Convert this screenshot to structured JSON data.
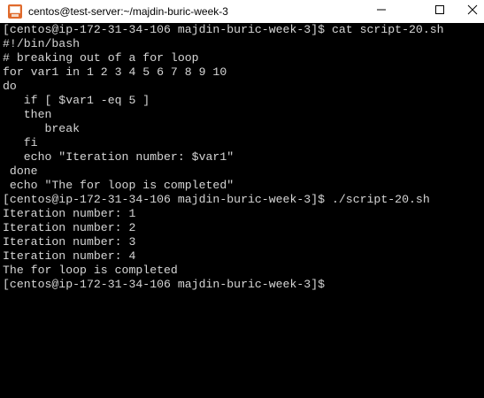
{
  "window": {
    "title": "centos@test-server:~/majdin-buric-week-3",
    "app_icon": "putty-terminal-icon",
    "controls": {
      "minimize_icon": "minimize-icon",
      "maximize_icon": "maximize-icon",
      "close_icon": "close-icon"
    }
  },
  "terminal": {
    "colors": {
      "background": "#000000",
      "foreground": "#d6d6d6"
    },
    "lines": [
      "[centos@ip-172-31-34-106 majdin-buric-week-3]$ cat script-20.sh",
      "#!/bin/bash",
      "# breaking out of a for loop",
      "for var1 in 1 2 3 4 5 6 7 8 9 10",
      "do",
      "   if [ $var1 -eq 5 ]",
      "   then",
      "      break",
      "   fi",
      "   echo \"Iteration number: $var1\"",
      " done",
      " echo \"The for loop is completed\"",
      "[centos@ip-172-31-34-106 majdin-buric-week-3]$ ./script-20.sh",
      "Iteration number: 1",
      "Iteration number: 2",
      "Iteration number: 3",
      "Iteration number: 4",
      "The for loop is completed",
      "[centos@ip-172-31-34-106 majdin-buric-week-3]$"
    ]
  }
}
